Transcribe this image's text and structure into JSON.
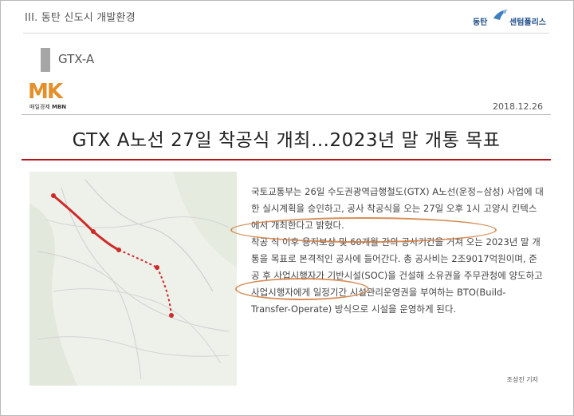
{
  "slide": {
    "section_title": "III. 동탄 신도시 개발환경",
    "subtitle": "GTX-A",
    "logo": {
      "text_left": "동탄",
      "text_right": "센텀폴리스",
      "mark_icon": "bird-mark-icon"
    }
  },
  "article": {
    "source_logo": {
      "letters": "MK",
      "caption_left": "매일경제",
      "caption_right": "MBN"
    },
    "date": "2018.12.26",
    "headline": "GTX A노선 27일 착공식 개최…2023년 말 개통 목표",
    "paragraphs": [
      "국토교통부는 26일 수도권광역급행철도(GTX) A노선(운정~삼성) 사업에 대한 실시계획을 승인하고, 공사 착공식을 오는 27일 오후 1시 고양시 킨텍스에서 개최한다고 밝혔다.",
      "착공 식 이후 용지보상 및 60개월 간의 공사기간을 거쳐 오는 2023년 말 개통을 목표로 본격적인 공사에 들어간다. 총 공사비는 2조9017억원이며, 준공 후 사업시행자가 기반시설(SOC)을 건설해 소유권을 주무관청에 양도하고 사업시행자에게 일정기간 시설관리운영권을 부여하는 BTO(Build-Transfer-Operate) 방식으로 시설을 운영하게 된다."
    ],
    "reporter": "조성진 기자"
  },
  "colors": {
    "accent_red": "#b3121b",
    "mk_orange": "#e3902b",
    "highlight_orange": "#d07a3c",
    "brand_blue": "#1f4e8c"
  }
}
